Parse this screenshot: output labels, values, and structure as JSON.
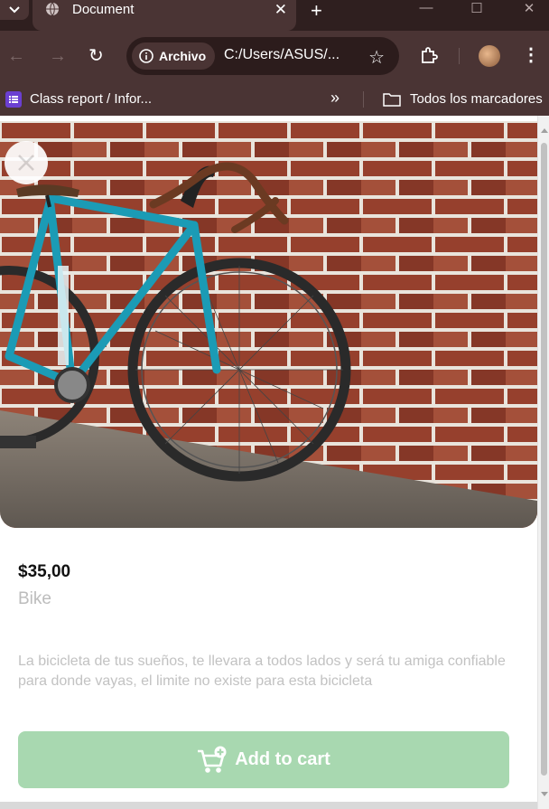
{
  "browser": {
    "tab": {
      "title": "Document",
      "close_glyph": "✕",
      "favicon": "globe-icon"
    },
    "new_tab_glyph": "+",
    "window_controls": [
      "—",
      "☐",
      "✕"
    ],
    "toolbar": {
      "site_chip_label": "Archivo",
      "url": "C:/Users/ASUS/...",
      "star_glyph": "☆",
      "menu_glyph": "⋮"
    },
    "bookmarks": {
      "item_label": "Class report / Infor...",
      "overflow_glyph": "»",
      "all_bookmarks_label": "Todos los marcadores"
    }
  },
  "product": {
    "price": "$35,00",
    "name": "Bike",
    "description": "La bicicleta de tus sueños, te llevara a todos lados y será tu amiga confiable para donde vayas, el limite no existe para esta bicicleta",
    "add_to_cart_label": "Add to cart"
  },
  "colors": {
    "browser_frame": "#4a3434",
    "tabstrip": "#2f1f1f",
    "cart_button": "#a8d8b0",
    "bike_frame": "#1b9bb5",
    "brick": "#8a3b2a"
  }
}
